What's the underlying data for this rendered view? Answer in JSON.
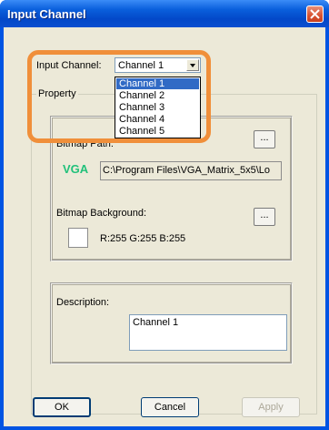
{
  "window": {
    "title": "Input Channel"
  },
  "input_channel": {
    "label": "Input Channel:",
    "selected": "Channel 1",
    "options": [
      "Channel 1",
      "Channel 2",
      "Channel 3",
      "Channel 4",
      "Channel 5"
    ]
  },
  "property": {
    "group_label": "Property",
    "bitmap_path_label": "Bitmap Path:",
    "browse_label": "...",
    "vga_logo": "VGA",
    "bitmap_path": "C:\\Program Files\\VGA_Matrix_5x5\\Lo",
    "bitmap_bg_label": "Bitmap Background:",
    "bg_browse_label": "...",
    "rgb": "R:255  G:255  B:255",
    "swatch_color": "#ffffff"
  },
  "description": {
    "label": "Description:",
    "value": "Channel 1"
  },
  "buttons": {
    "ok": "OK",
    "cancel": "Cancel",
    "apply": "Apply"
  }
}
